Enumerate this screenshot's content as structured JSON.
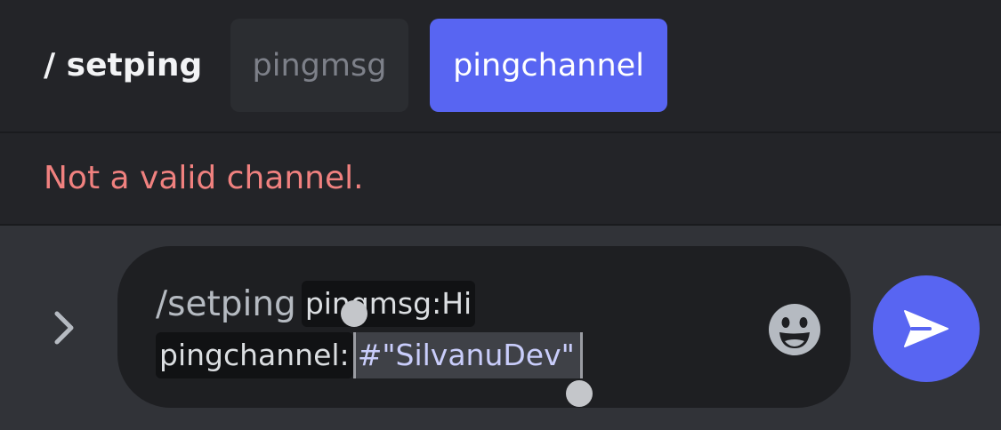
{
  "command_bar": {
    "command_name": "/ setping",
    "options": [
      {
        "label": "pingmsg",
        "selected": false
      },
      {
        "label": "pingchannel",
        "selected": true
      }
    ]
  },
  "error": {
    "message": "Not a valid channel."
  },
  "composer": {
    "command_text": "/setping",
    "option1_text": "pingmsg:Hi",
    "option2_key": "pingchannel:",
    "option2_value": "#\"SilvanuDev\"",
    "expand_icon": "chevron-right-icon",
    "emoji_icon": "smiley-icon",
    "send_icon": "send-icon"
  },
  "colors": {
    "accent": "#5865f2",
    "error": "#f0817f",
    "background": "#313338",
    "panel": "#232428"
  }
}
